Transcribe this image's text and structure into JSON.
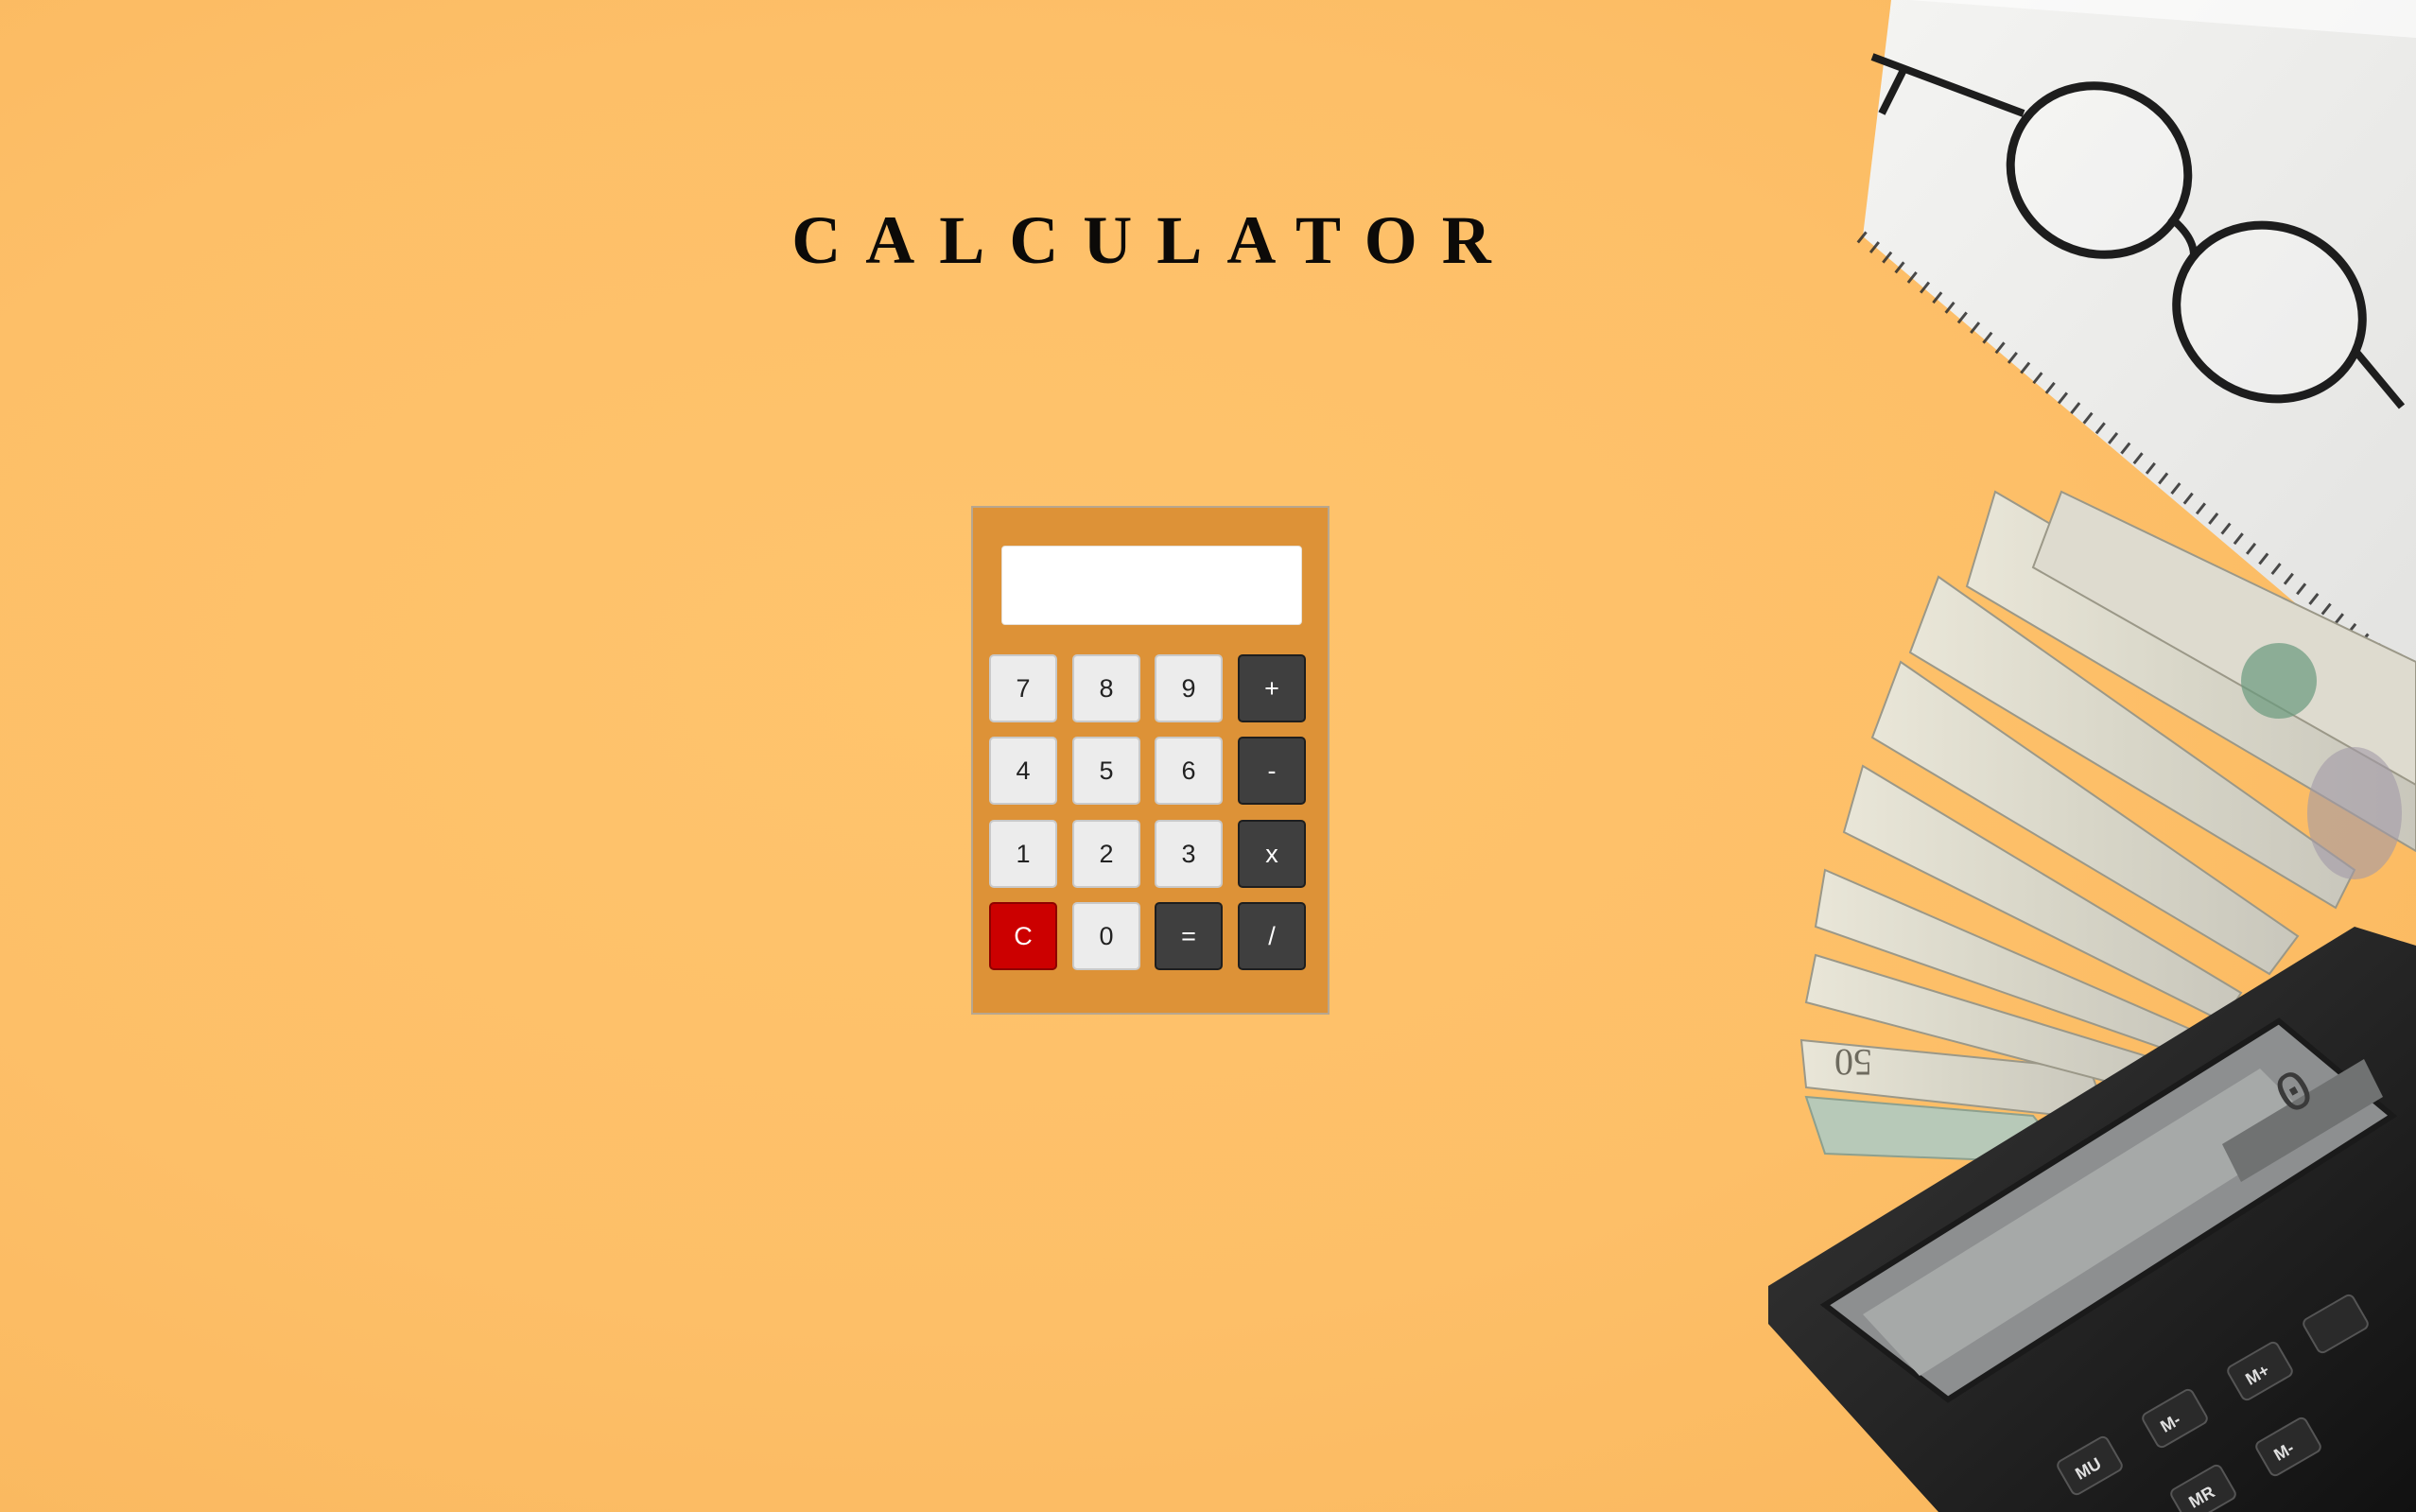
{
  "page": {
    "title": "CALCULATOR"
  },
  "calculator": {
    "display_value": "",
    "keys": [
      [
        "7",
        "8",
        "9",
        "+"
      ],
      [
        "4",
        "5",
        "6",
        "-"
      ],
      [
        "1",
        "2",
        "3",
        "x"
      ],
      [
        "C",
        "0",
        "=",
        "/"
      ]
    ]
  },
  "colors": {
    "background": "#fdbf68",
    "calculator_body": "#dd9237",
    "number_key": "#ececec",
    "operator_key": "#3f3f3f",
    "clear_key": "#cc0000"
  },
  "decoration": {
    "photo_display_digit": "0",
    "photo_keys": [
      "MU",
      "M-",
      "M+",
      "MR",
      "M-"
    ],
    "banknote_value": "50"
  }
}
